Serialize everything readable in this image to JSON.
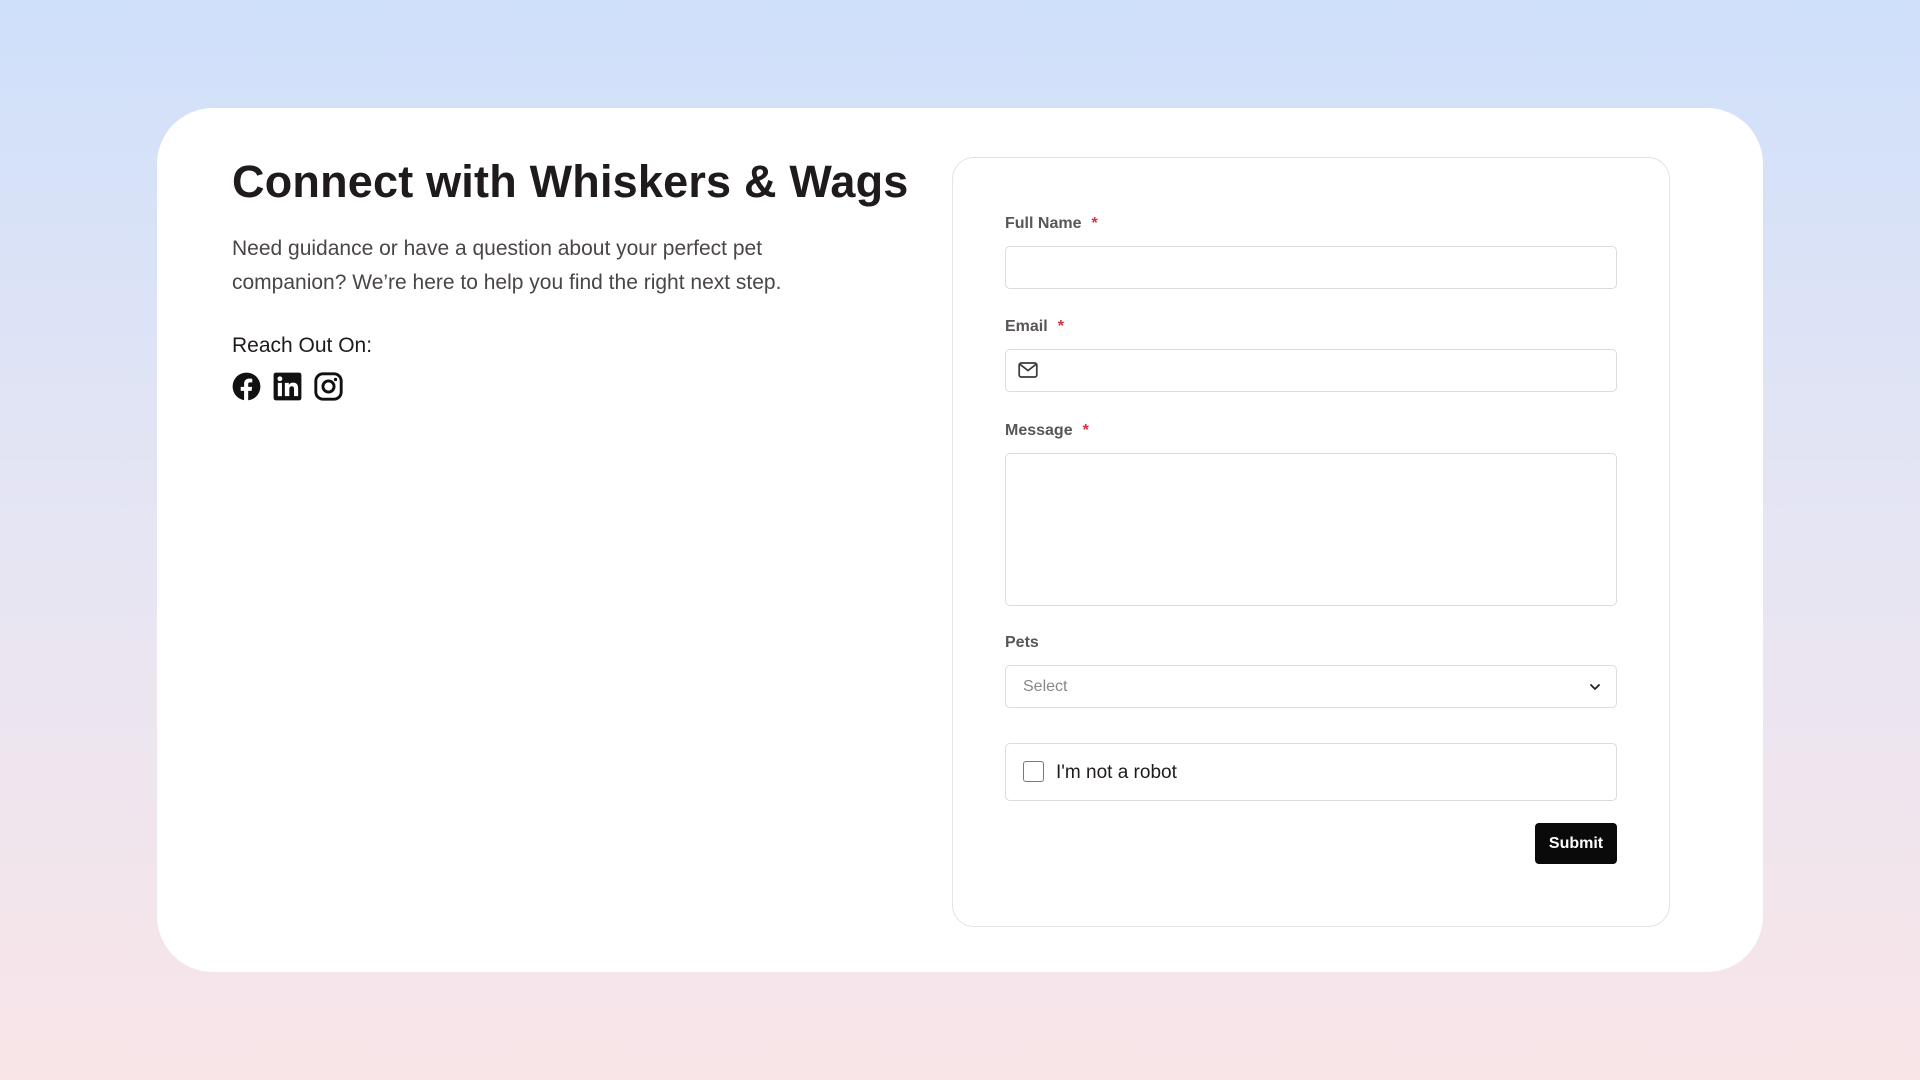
{
  "intro": {
    "title": "Connect with Whiskers & Wags",
    "description": "Need guidance or have a question about your perfect pet companion? We’re here to help you find the right next step.",
    "reach_label": "Reach Out On:",
    "socials": [
      {
        "icon": "facebook-icon"
      },
      {
        "icon": "linkedin-icon"
      },
      {
        "icon": "instagram-icon"
      }
    ]
  },
  "form": {
    "full_name": {
      "label": "Full Name",
      "required_mark": "*",
      "value": ""
    },
    "email": {
      "label": "Email",
      "required_mark": "*",
      "icon": "mail-icon",
      "value": ""
    },
    "message": {
      "label": "Message",
      "required_mark": "*",
      "value": ""
    },
    "pets": {
      "label": "Pets",
      "placeholder": "Select",
      "icon": "chevron-down-icon"
    },
    "captcha": {
      "label": "I'm not a robot",
      "checked": false
    },
    "submit_label": "Submit"
  },
  "colors": {
    "required": "#d2323c",
    "button_bg": "#0a0a0a",
    "gradient_top": "#cfe0fa",
    "gradient_bottom": "#f9e5e8"
  }
}
